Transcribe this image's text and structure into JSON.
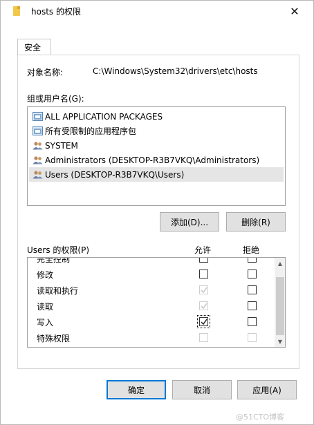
{
  "window": {
    "title": "hosts 的权限",
    "close_glyph": "✕"
  },
  "tabs": [
    {
      "label": "安全"
    }
  ],
  "object": {
    "label": "对象名称:",
    "value": "C:\\Windows\\System32\\drivers\\etc\\hosts"
  },
  "groups": {
    "label": "组或用户名(G):",
    "items": [
      {
        "label": "ALL APPLICATION PACKAGES",
        "icon": "app-package-icon"
      },
      {
        "label": "所有受限制的应用程序包",
        "icon": "app-package-icon"
      },
      {
        "label": "SYSTEM",
        "icon": "users-icon"
      },
      {
        "label": "Administrators (DESKTOP-R3B7VKQ\\Administrators)",
        "icon": "users-icon"
      },
      {
        "label": "Users (DESKTOP-R3B7VKQ\\Users)",
        "icon": "users-icon",
        "selected": true
      }
    ],
    "add_label": "添加(D)...",
    "remove_label": "删除(R)"
  },
  "permissions": {
    "title": "Users 的权限(P)",
    "allow_header": "允许",
    "deny_header": "拒绝",
    "rows": [
      {
        "name": "完全控制",
        "allow": false,
        "deny": false
      },
      {
        "name": "修改",
        "allow": false,
        "deny": false
      },
      {
        "name": "读取和执行",
        "allow": true,
        "allow_disabled": true,
        "deny": false
      },
      {
        "name": "读取",
        "allow": true,
        "allow_disabled": true,
        "deny": false
      },
      {
        "name": "写入",
        "allow": true,
        "deny": false,
        "focused": true
      },
      {
        "name": "特殊权限",
        "allow": false,
        "allow_disabled": true,
        "deny": false,
        "deny_disabled": true
      }
    ]
  },
  "footer": {
    "ok_label": "确定",
    "cancel_label": "取消",
    "apply_label": "应用(A)"
  },
  "watermark": "@51CTO博客",
  "colors": {
    "focus_border": "#0078d7",
    "selection": "#e5e5e5"
  }
}
